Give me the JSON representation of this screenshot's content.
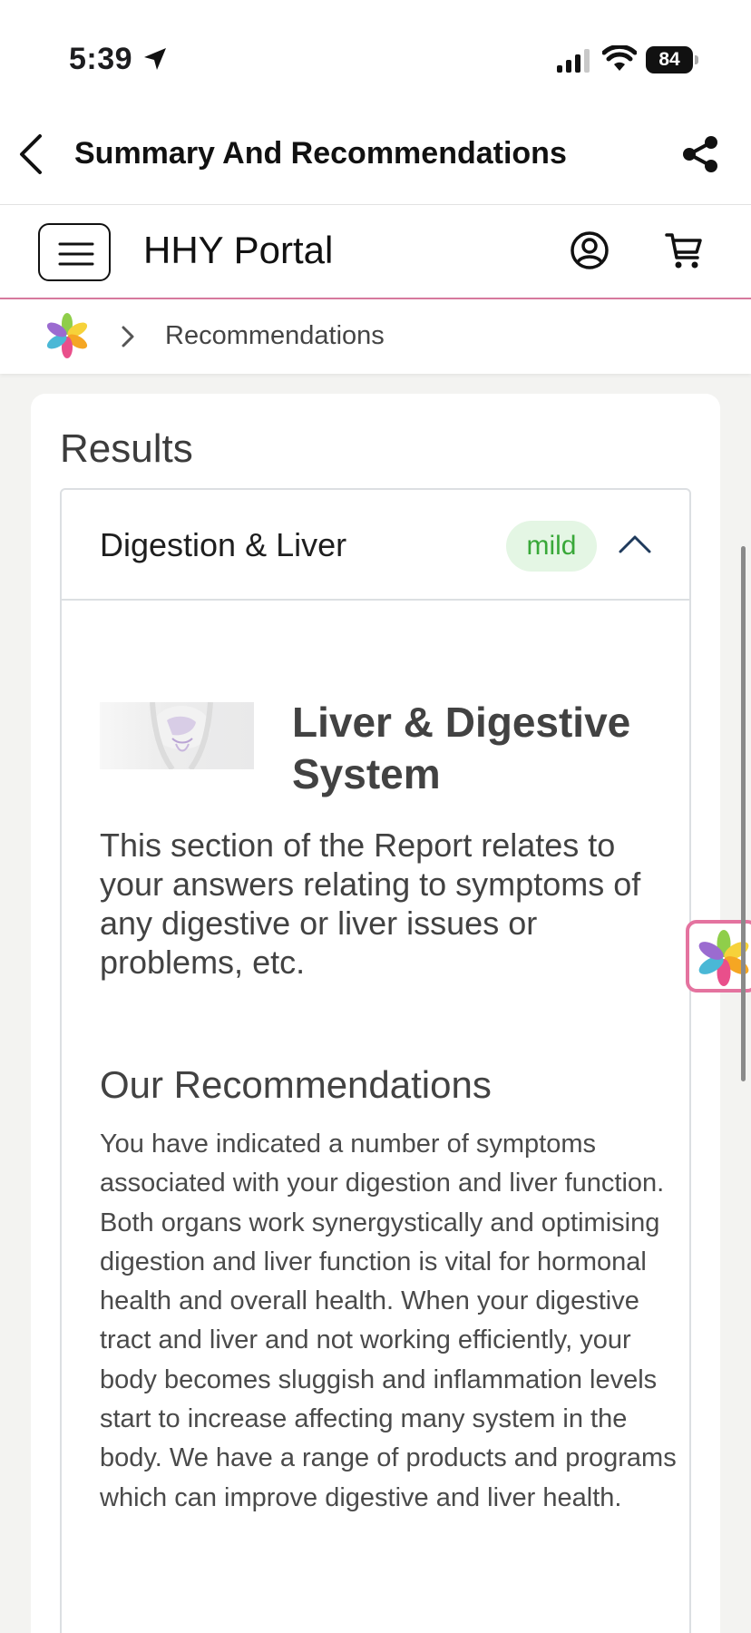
{
  "status_bar": {
    "time": "5:39",
    "battery": "84",
    "icons": [
      "location-arrow-icon",
      "signal-icon",
      "wifi-icon",
      "battery-icon"
    ]
  },
  "nav": {
    "title": "Summary And Recommendations",
    "icons": [
      "chevron-left-icon",
      "share-icon"
    ]
  },
  "portal": {
    "title": "HHY Portal",
    "icons": [
      "hamburger-menu-icon",
      "user-circle-icon",
      "cart-icon"
    ]
  },
  "breadcrumb": {
    "current": "Recommendations",
    "icons": [
      "flower-logo-icon",
      "chevron-right-icon"
    ]
  },
  "results": {
    "title": "Results",
    "accordion": {
      "title": "Digestion & Liver",
      "badge": "mild",
      "badge_color": "#38a838",
      "expanded": true,
      "section_title": "Liver & Digestive System",
      "section_description": "This section of the Report relates to your answers relating to symptoms of any digestive or liver issues or problems, etc.",
      "recommendations_heading": "Our Recommendations",
      "recommendations_body": "You have indicated a number of symptoms associated with your digestion and liver function. Both organs work synergystically and optimising digestion and liver function is vital for hormonal health and overall health. When your digestive tract and liver and not working efficiently, your body becomes sluggish and inflammation levels start to increase affecting many system in the body. We have a range of products and programs which can improve digestive and liver health."
    }
  },
  "colors": {
    "accent_pink": "#d7799e",
    "badge_bg": "#e4f6e4",
    "text_dark": "#424242"
  }
}
